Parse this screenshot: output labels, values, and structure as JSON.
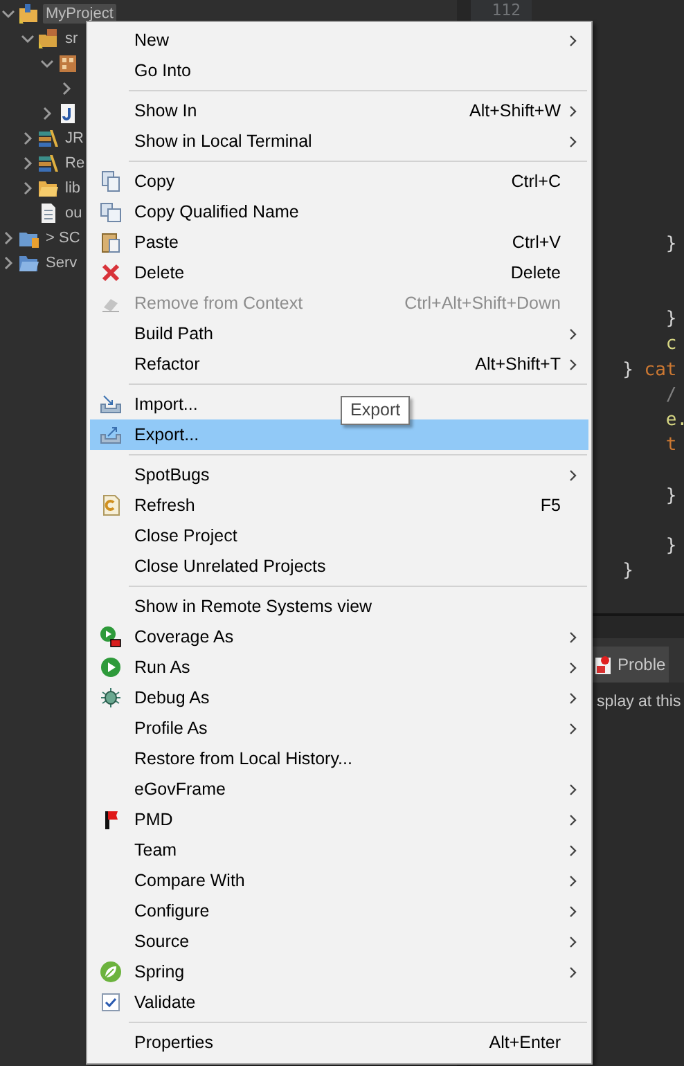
{
  "project_explorer": {
    "items": [
      {
        "label": "MyProject",
        "kind": "project",
        "expanded": true,
        "selected": true,
        "children": [
          {
            "label": "sr",
            "kind": "source-folder",
            "expanded": true,
            "selected": false,
            "children": [
              {
                "kind": "package",
                "expanded": true,
                "children": [
                  {
                    "expanded": false
                  }
                ]
              },
              {
                "kind": "java-file",
                "expanded": false
              }
            ]
          },
          {
            "label": "JR",
            "kind": "library",
            "expanded": false,
            "selected": false
          },
          {
            "label": "Re",
            "kind": "library",
            "expanded": false,
            "selected": false
          },
          {
            "label": "lib",
            "kind": "folder",
            "expanded": false,
            "selected": false
          },
          {
            "label": "ou",
            "kind": "file",
            "selected": false
          }
        ]
      },
      {
        "label": "> SC",
        "kind": "server-project",
        "expanded": false,
        "selected": false
      },
      {
        "label": "Serv",
        "kind": "folder-project",
        "expanded": false,
        "selected": false
      }
    ]
  },
  "editor": {
    "line_numbers": [
      "112"
    ],
    "lines": [
      {
        "blank": true
      },
      {
        "blank": true
      },
      {
        "blank": true
      },
      {
        "blank": true
      },
      {
        "blank": true
      },
      {
        "blank": true
      },
      {
        "blank": true
      },
      {
        "blank": true
      },
      {
        "blank": true
      },
      {
        "tokens": [
          {
            "kind": "plain",
            "text": "            }"
          }
        ]
      },
      {
        "blank": true
      },
      {
        "blank": true
      },
      {
        "tokens": [
          {
            "kind": "plain",
            "text": "            }"
          }
        ]
      },
      {
        "tokens": [
          {
            "kind": "field",
            "text": "            c"
          }
        ]
      },
      {
        "tokens": [
          {
            "kind": "plain",
            "text": "        }"
          },
          {
            "kind": "keyword",
            "text": "cat"
          }
        ]
      },
      {
        "tokens": [
          {
            "kind": "comment",
            "text": "            /"
          }
        ]
      },
      {
        "tokens": [
          {
            "kind": "field",
            "text": "            e."
          }
        ]
      },
      {
        "tokens": [
          {
            "kind": "keyword",
            "text": "            t"
          }
        ]
      },
      {
        "blank": true
      },
      {
        "tokens": [
          {
            "kind": "plain",
            "text": "            }"
          }
        ]
      },
      {
        "blank": true
      },
      {
        "tokens": [
          {
            "kind": "plain",
            "text": "            }"
          }
        ]
      },
      {
        "tokens": [
          {
            "kind": "plain",
            "text": "        }"
          }
        ]
      }
    ]
  },
  "bottom_panel": {
    "tabs": [
      {
        "label": "Proble"
      }
    ],
    "message": "splay at this"
  },
  "context_menu": {
    "items": [
      {
        "kind": "item",
        "label": "New",
        "submenu": true
      },
      {
        "kind": "item",
        "label": "Go Into"
      },
      {
        "kind": "separator"
      },
      {
        "kind": "item",
        "label": "Show In",
        "shortcut": "Alt+Shift+W",
        "submenu": true
      },
      {
        "kind": "item",
        "label": "Show in Local Terminal",
        "submenu": true
      },
      {
        "kind": "separator"
      },
      {
        "kind": "item",
        "label": "Copy",
        "shortcut": "Ctrl+C"
      },
      {
        "kind": "item",
        "label": "Copy Qualified Name"
      },
      {
        "kind": "item",
        "label": "Paste",
        "shortcut": "Ctrl+V"
      },
      {
        "kind": "item",
        "label": "Delete",
        "shortcut": "Delete"
      },
      {
        "kind": "item",
        "label": "Remove from Context",
        "shortcut": "Ctrl+Alt+Shift+Down",
        "disabled": true
      },
      {
        "kind": "item",
        "label": "Build Path",
        "submenu": true
      },
      {
        "kind": "item",
        "label": "Refactor",
        "shortcut": "Alt+Shift+T",
        "submenu": true
      },
      {
        "kind": "separator"
      },
      {
        "kind": "item",
        "label": "Import...",
        "selected": false
      },
      {
        "kind": "item",
        "label": "Export...",
        "selected": true
      },
      {
        "kind": "separator"
      },
      {
        "kind": "item",
        "label": "SpotBugs",
        "submenu": true
      },
      {
        "kind": "item",
        "label": "Refresh",
        "shortcut": "F5"
      },
      {
        "kind": "item",
        "label": "Close Project"
      },
      {
        "kind": "item",
        "label": "Close Unrelated Projects"
      },
      {
        "kind": "separator"
      },
      {
        "kind": "item",
        "label": "Show in Remote Systems view"
      },
      {
        "kind": "item",
        "label": "Coverage As",
        "submenu": true
      },
      {
        "kind": "item",
        "label": "Run As",
        "submenu": true
      },
      {
        "kind": "item",
        "label": "Debug As",
        "submenu": true
      },
      {
        "kind": "item",
        "label": "Profile As",
        "submenu": true
      },
      {
        "kind": "item",
        "label": "Restore from Local History..."
      },
      {
        "kind": "item",
        "label": "eGovFrame",
        "submenu": true
      },
      {
        "kind": "item",
        "label": "PMD",
        "submenu": true
      },
      {
        "kind": "item",
        "label": "Team",
        "submenu": true
      },
      {
        "kind": "item",
        "label": "Compare With",
        "submenu": true
      },
      {
        "kind": "item",
        "label": "Configure",
        "submenu": true
      },
      {
        "kind": "item",
        "label": "Source",
        "submenu": true
      },
      {
        "kind": "item",
        "label": "Spring",
        "submenu": true
      },
      {
        "kind": "item",
        "label": "Validate"
      },
      {
        "kind": "separator"
      },
      {
        "kind": "item",
        "label": "Properties",
        "shortcut": "Alt+Enter"
      }
    ]
  },
  "tooltip": {
    "text": "Export"
  }
}
